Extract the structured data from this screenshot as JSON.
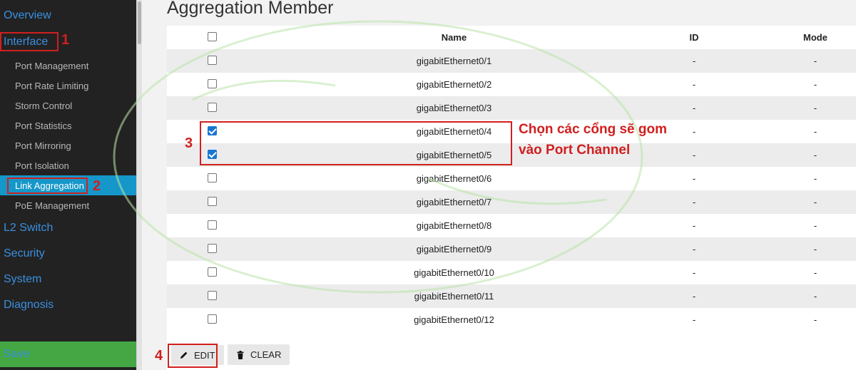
{
  "sidebar": {
    "overview": "Overview",
    "interface": "Interface",
    "sub_items": [
      "Port Management",
      "Port Rate Limiting",
      "Storm Control",
      "Port Statistics",
      "Port Mirroring",
      "Port Isolation",
      "Link Aggregation",
      "PoE Management"
    ],
    "active_item": "Link Aggregation",
    "l2_switch": "L2 Switch",
    "security": "Security",
    "system": "System",
    "diagnosis": "Diagnosis",
    "save": "Save"
  },
  "main": {
    "title": "Aggregation Member",
    "columns": {
      "name": "Name",
      "id": "ID",
      "mode": "Mode"
    },
    "rows": [
      {
        "name": "gigabitEthernet0/1",
        "id": "-",
        "mode": "-",
        "checked": false
      },
      {
        "name": "gigabitEthernet0/2",
        "id": "-",
        "mode": "-",
        "checked": false
      },
      {
        "name": "gigabitEthernet0/3",
        "id": "-",
        "mode": "-",
        "checked": false
      },
      {
        "name": "gigabitEthernet0/4",
        "id": "-",
        "mode": "-",
        "checked": true
      },
      {
        "name": "gigabitEthernet0/5",
        "id": "-",
        "mode": "-",
        "checked": true
      },
      {
        "name": "gigabitEthernet0/6",
        "id": "-",
        "mode": "-",
        "checked": false
      },
      {
        "name": "gigabitEthernet0/7",
        "id": "-",
        "mode": "-",
        "checked": false
      },
      {
        "name": "gigabitEthernet0/8",
        "id": "-",
        "mode": "-",
        "checked": false
      },
      {
        "name": "gigabitEthernet0/9",
        "id": "-",
        "mode": "-",
        "checked": false
      },
      {
        "name": "gigabitEthernet0/10",
        "id": "-",
        "mode": "-",
        "checked": false
      },
      {
        "name": "gigabitEthernet0/11",
        "id": "-",
        "mode": "-",
        "checked": false
      },
      {
        "name": "gigabitEthernet0/12",
        "id": "-",
        "mode": "-",
        "checked": false
      }
    ],
    "edit_label": "EDIT",
    "clear_label": "CLEAR"
  },
  "annotations": {
    "n1": "1",
    "n2": "2",
    "n3": "3",
    "n4": "4",
    "callout_line1": "Chọn các cổng sẽ gom",
    "callout_line2": "vào Port Channel"
  },
  "colors": {
    "sidebar_bg": "#222222",
    "nav_link": "#3a8fe0",
    "active_bg": "#1597c9",
    "save_bg": "#44a744",
    "annotation_red": "#d11f1f",
    "checkbox_blue": "#1976d2"
  },
  "icons": {
    "edit": "pencil-icon",
    "clear": "trash-icon"
  }
}
